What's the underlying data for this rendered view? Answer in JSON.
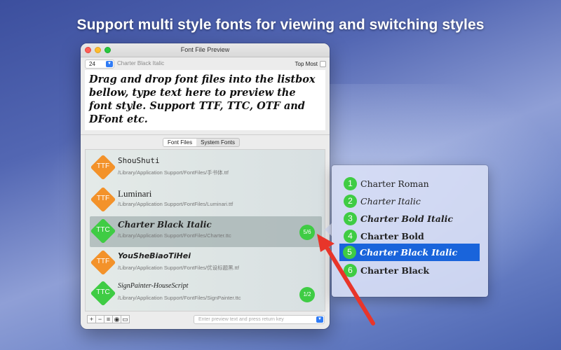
{
  "headline": "Support multi style fonts for viewing and switching styles",
  "window": {
    "title": "Font File Preview",
    "size_value": "24",
    "font_name": "Charter Black Italic",
    "top_most_label": "Top Most",
    "preview_text": "Drag and drop font files into the listbox bellow, type text here to preview the font style. Support TTF, TTC, OTF and DFont etc.",
    "tabs": [
      "Font Files",
      "System Fonts"
    ],
    "active_tab": "Font Files",
    "files": [
      {
        "type": "TTF",
        "name": "ShouShuti",
        "path": "/Library/Application Support/FontFiles/手书体.ttf",
        "badge": ""
      },
      {
        "type": "TTF",
        "name": "Luminari",
        "path": "/Library/Application Support/FontFiles/Luminari.ttf",
        "badge": ""
      },
      {
        "type": "TTC",
        "name": "Charter Black Italic",
        "path": "/Library/Application Support/FontFiles/Charter.ttc",
        "badge": "5/6"
      },
      {
        "type": "TTF",
        "name": "YouSheBiaoTiHei",
        "path": "/Library/Application Support/FontFiles/优设标题黑.ttf",
        "badge": ""
      },
      {
        "type": "TTC",
        "name": "SignPainter-HouseScript",
        "path": "/Library/Application Support/FontFiles/SignPainter.ttc",
        "badge": "1/2"
      }
    ],
    "bottom_buttons": [
      "+",
      "−",
      "≡",
      "◉",
      "▭"
    ],
    "entry_placeholder": "Enter preview text and press return key"
  },
  "styles_popup": {
    "items": [
      {
        "num": "1",
        "label": "Charter Roman"
      },
      {
        "num": "2",
        "label": "Charter Italic"
      },
      {
        "num": "3",
        "label": "Charter Bold Italic"
      },
      {
        "num": "4",
        "label": "Charter Bold"
      },
      {
        "num": "5",
        "label": "Charter Black Italic"
      },
      {
        "num": "6",
        "label": "Charter Black"
      }
    ],
    "selected_index": 4
  },
  "colors": {
    "accent": "#1964db",
    "ttf_badge": "#f3922a",
    "ttc_badge": "#3fcc44",
    "arrow": "#e8352a"
  },
  "icons": {
    "type_badge": "diamond-shape",
    "dropdown": "chevron-down-icon",
    "arrow": "red-arrow-icon"
  }
}
